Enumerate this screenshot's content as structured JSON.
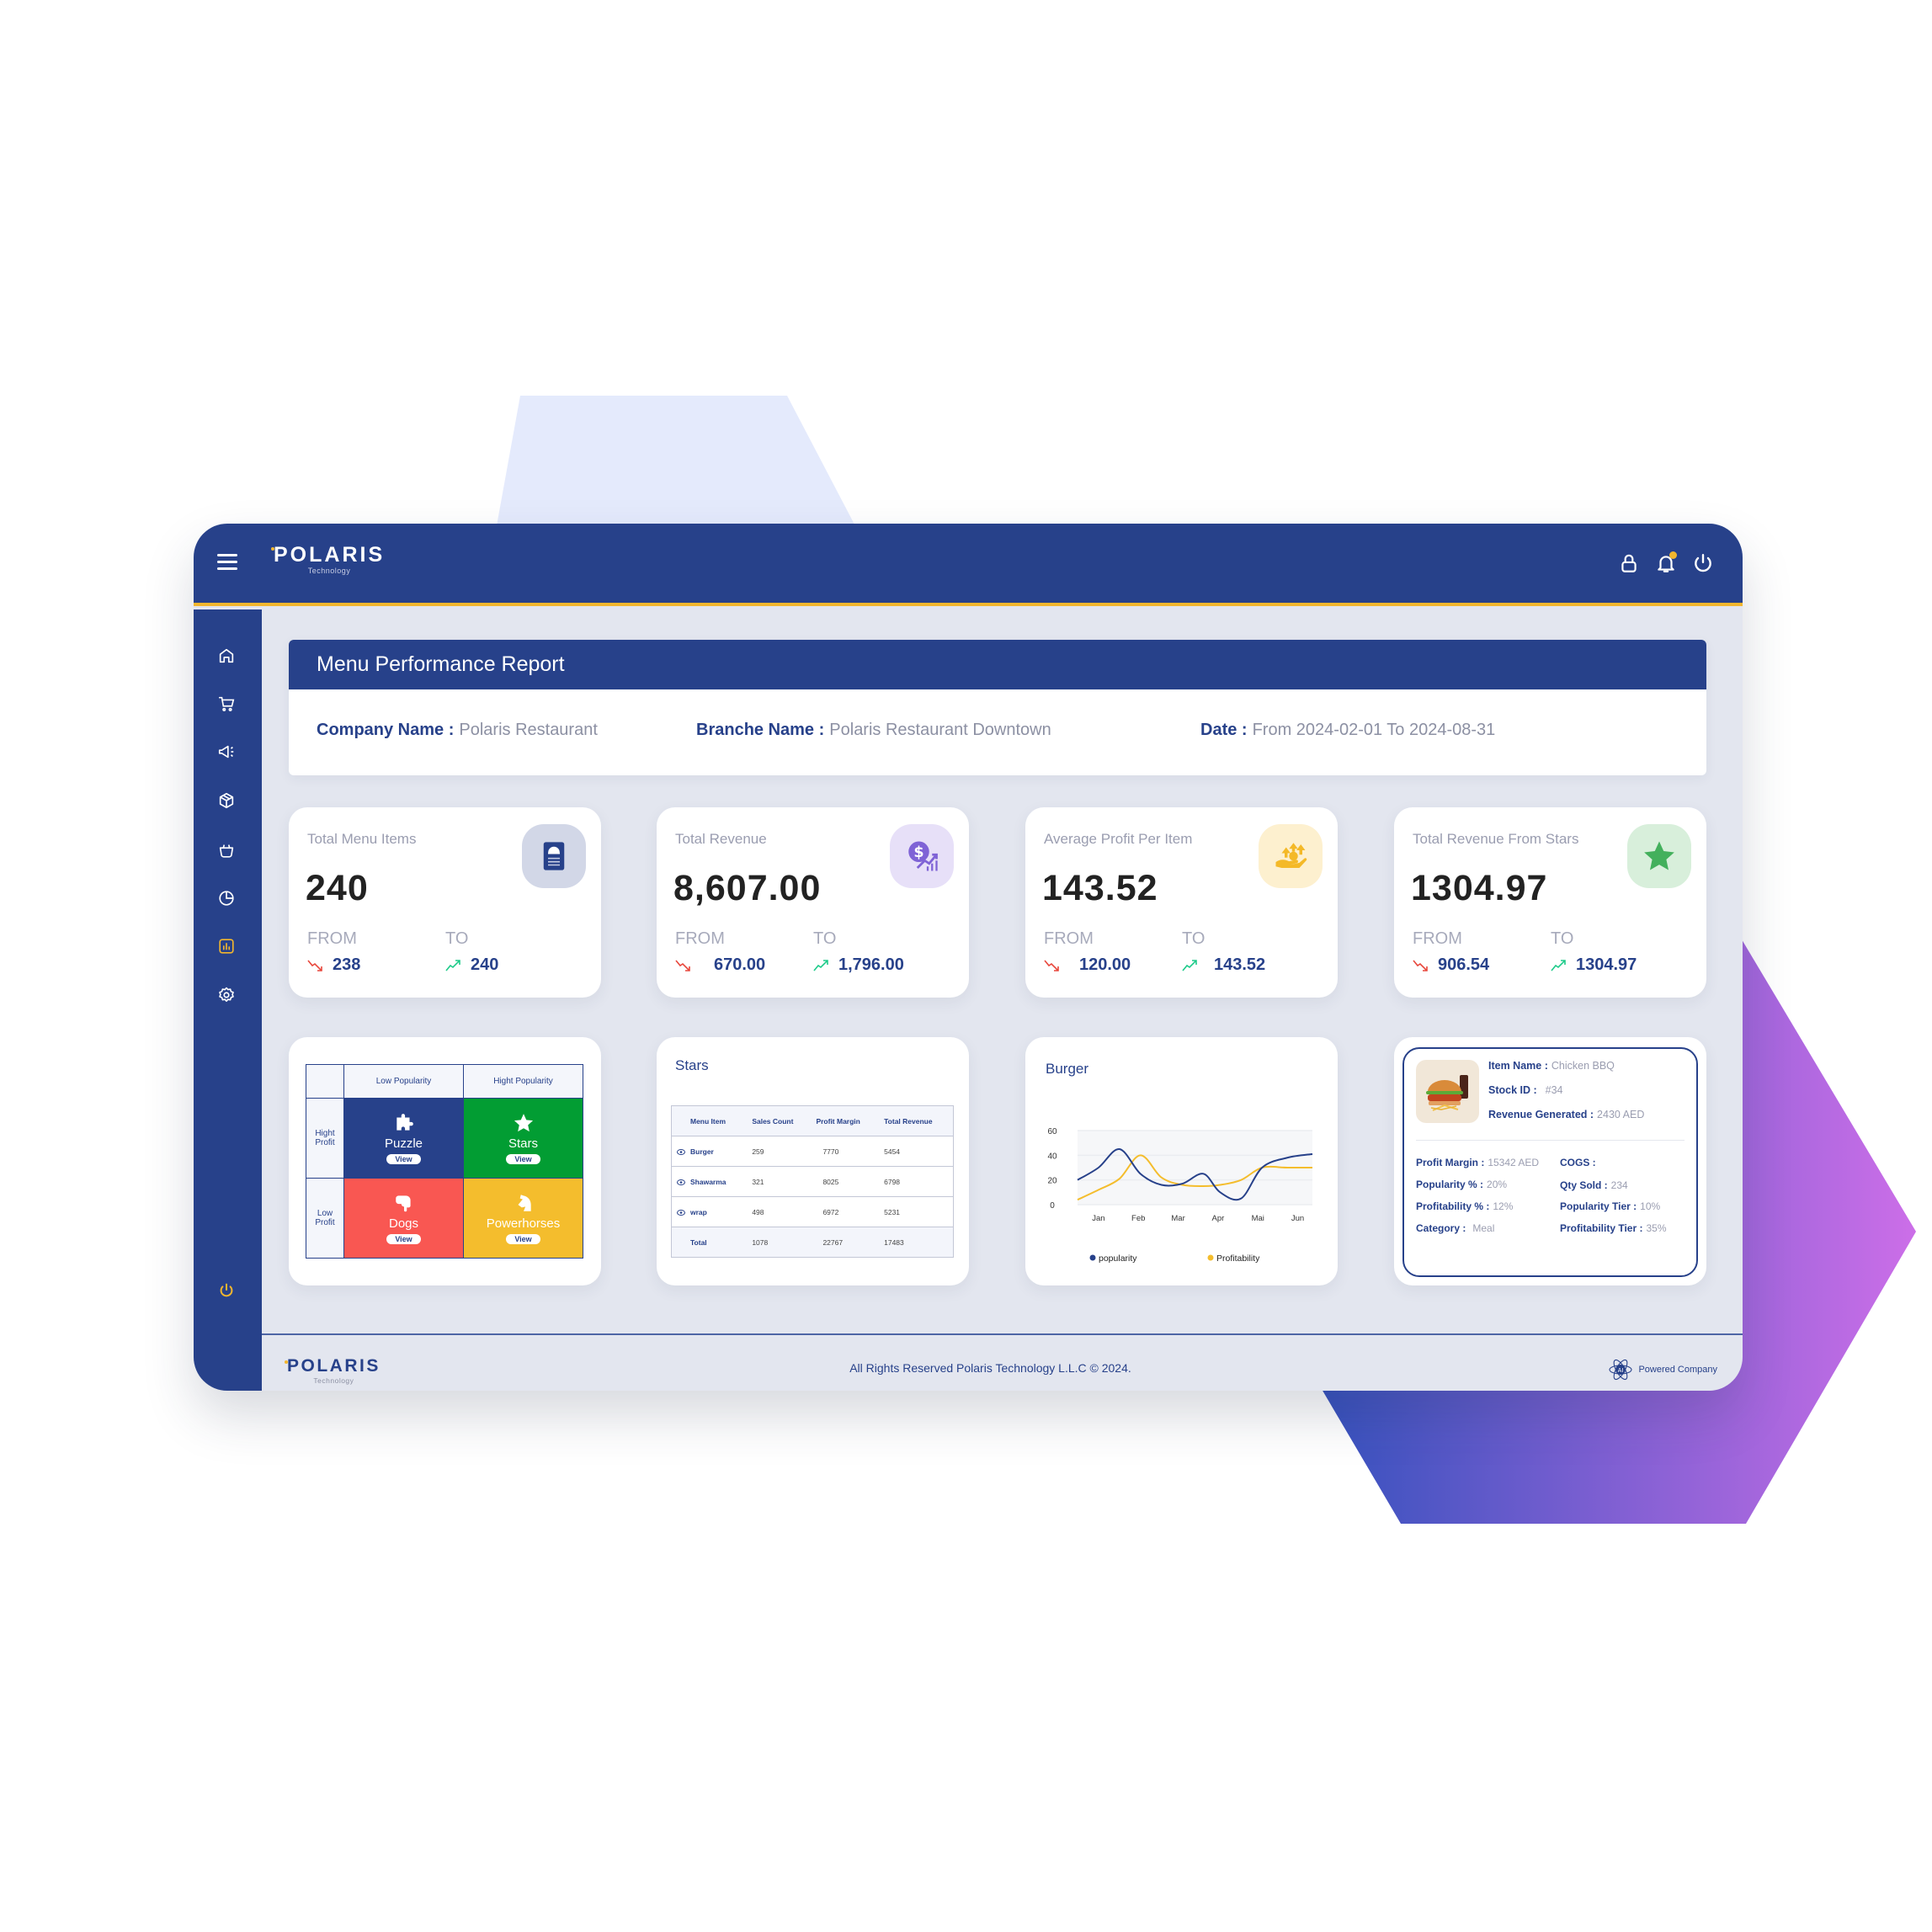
{
  "colors": {
    "primary": "#27418a",
    "accent": "#f2b62e",
    "background": "#e3e6ef",
    "down": "#e8473c",
    "up": "#1ecb8a",
    "puzzle": "#27418a",
    "stars": "#029d33",
    "dogs": "#f95752",
    "powerhorses": "#f4bd2d"
  },
  "header": {
    "logo_text": "POLARIS",
    "logo_sub": "Technology",
    "icons": [
      "menu-icon",
      "lock-icon",
      "bell-icon",
      "power-icon"
    ]
  },
  "sidebar": {
    "items": [
      {
        "icon": "home-icon",
        "active": false
      },
      {
        "icon": "cart-icon",
        "active": false
      },
      {
        "icon": "megaphone-icon",
        "active": false
      },
      {
        "icon": "package-icon",
        "active": false
      },
      {
        "icon": "basket-icon",
        "active": false
      },
      {
        "icon": "pie-chart-icon",
        "active": false
      },
      {
        "icon": "bar-chart-icon",
        "active": true
      },
      {
        "icon": "settings-icon",
        "active": false
      }
    ],
    "bottom_icon": "logout-icon"
  },
  "report": {
    "title": "Menu Performance Report",
    "company_label": "Company Name :",
    "company_value": "Polaris Restaurant",
    "branch_label": "Branche Name :",
    "branch_value": "Polaris Restaurant Downtown",
    "date_label": "Date :",
    "date_value": "From 2024-02-01 To 2024-08-31"
  },
  "stats": [
    {
      "label": "Total Menu Items",
      "value": "240",
      "from_label": "FROM",
      "from": "238",
      "to_label": "TO",
      "to": "240",
      "icon": "menu-card-icon",
      "icon_bg": "#d2d7e7"
    },
    {
      "label": "Total Revenue",
      "value": "8,607.00",
      "from_label": "FROM",
      "from": "670.00",
      "to_label": "TO",
      "to": "1,796.00",
      "icon": "revenue-growth-icon",
      "icon_bg": "#e7e0f8"
    },
    {
      "label": "Average Profit Per Item",
      "value": "143.52",
      "from_label": "FROM",
      "from": "120.00",
      "to_label": "TO",
      "to": "143.52",
      "icon": "profit-hand-icon",
      "icon_bg": "#fdf0cf"
    },
    {
      "label": "Total Revenue From Stars",
      "value": "1304.97",
      "from_label": "FROM",
      "from": "906.54",
      "to_label": "TO",
      "to": "1304.97",
      "icon": "star-icon",
      "icon_bg": "#d8efdb"
    }
  ],
  "matrix": {
    "col_headers": [
      "Low Popularity",
      "Hight Popularity"
    ],
    "row_headers": [
      "Hight Profit",
      "Low Profit"
    ],
    "quadrants": [
      {
        "name": "Puzzle",
        "icon": "puzzle-icon",
        "view_label": "View"
      },
      {
        "name": "Stars",
        "icon": "star-icon",
        "view_label": "View"
      },
      {
        "name": "Dogs",
        "icon": "dog-icon",
        "view_label": "View"
      },
      {
        "name": "Powerhorses",
        "icon": "horse-icon",
        "view_label": "View"
      }
    ]
  },
  "stars_table": {
    "title": "Stars",
    "columns": [
      "Menu Item",
      "Sales Count",
      "Profit Margin",
      "Total Revenue"
    ],
    "rows": [
      {
        "item": "Burger",
        "sales": "259",
        "margin": "7770",
        "revenue": "5454"
      },
      {
        "item": "Shawarma",
        "sales": "321",
        "margin": "8025",
        "revenue": "6798"
      },
      {
        "item": "wrap",
        "sales": "498",
        "margin": "6972",
        "revenue": "5231"
      }
    ],
    "total": {
      "item": "Total",
      "sales": "1078",
      "margin": "22767",
      "revenue": "17483"
    }
  },
  "chart_data": {
    "type": "line",
    "title": "Burger",
    "categories": [
      "Jan",
      "Feb",
      "Mar",
      "Apr",
      "Mai",
      "Jun"
    ],
    "x": [
      0,
      0.5,
      1,
      1.5,
      2,
      2.5,
      3,
      3.4,
      3.9,
      4.4,
      5,
      5.6
    ],
    "series": [
      {
        "name": "popularity",
        "color": "#27418a",
        "values": [
          20,
          30,
          45,
          25,
          16,
          17,
          25,
          10,
          5,
          30,
          38,
          41
        ]
      },
      {
        "name": "Profitability",
        "color": "#f4bd2d",
        "values": [
          4,
          12,
          21,
          40,
          22,
          16,
          15,
          16,
          20,
          30,
          30,
          30
        ]
      }
    ],
    "yticks": [
      0,
      20,
      40,
      60
    ],
    "ylim": [
      0,
      60
    ],
    "legend": "bottom",
    "grid": true
  },
  "item_detail": {
    "item_name_label": "Item Name :",
    "item_name": "Chicken BBQ",
    "stock_label": "Stock ID :",
    "stock": "#34",
    "revenue_label": "Revenue Generated :",
    "revenue": "2430 AED",
    "fields_left": [
      {
        "label": "Profit Margin :",
        "value": "15342 AED"
      },
      {
        "label": "Popularity % :",
        "value": "20%"
      },
      {
        "label": "Profitability % :",
        "value": "12%"
      },
      {
        "label": "Category :",
        "value": "Meal"
      }
    ],
    "fields_right": [
      {
        "label": "COGS :",
        "value": ""
      },
      {
        "label": "Qty Sold :",
        "value": "234"
      },
      {
        "label": "Popularity Tier :",
        "value": "10%"
      },
      {
        "label": "Profitability Tier :",
        "value": "35%"
      }
    ]
  },
  "footer": {
    "logo_text": "POLARIS",
    "logo_sub": "Technology",
    "copyright": "All Rights Reserved Polaris Technology L.L.C © 2024.",
    "powered": "Powered Company",
    "powered_badge": "AI"
  }
}
